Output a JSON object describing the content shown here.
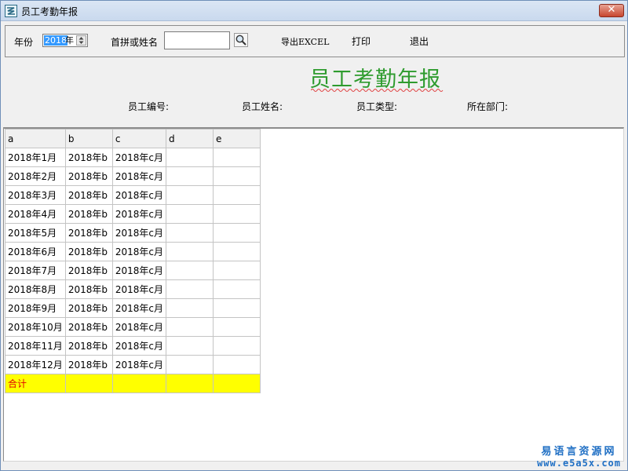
{
  "window": {
    "title": "员工考勤年报",
    "close_glyph": "✕"
  },
  "toolbar": {
    "year_label": "年份",
    "year_value": "2018",
    "year_suffix": "年",
    "search_label": "首拼或姓名",
    "search_value": "",
    "search_icon": "magnifier-icon",
    "export_label": "导出EXCEL",
    "print_label": "打印",
    "exit_label": "退出"
  },
  "report": {
    "title": "员工考勤年报",
    "fields": {
      "emp_no": "员工编号:",
      "emp_name": "员工姓名:",
      "emp_type": "员工类型:",
      "dept": "所在部门:"
    }
  },
  "grid": {
    "columns": [
      "a",
      "b",
      "c",
      "d",
      "e"
    ],
    "rows": [
      [
        "2018年1月",
        "2018年b",
        "2018年c月",
        "",
        ""
      ],
      [
        "2018年2月",
        "2018年b",
        "2018年c月",
        "",
        ""
      ],
      [
        "2018年3月",
        "2018年b",
        "2018年c月",
        "",
        ""
      ],
      [
        "2018年4月",
        "2018年b",
        "2018年c月",
        "",
        ""
      ],
      [
        "2018年5月",
        "2018年b",
        "2018年c月",
        "",
        ""
      ],
      [
        "2018年6月",
        "2018年b",
        "2018年c月",
        "",
        ""
      ],
      [
        "2018年7月",
        "2018年b",
        "2018年c月",
        "",
        ""
      ],
      [
        "2018年8月",
        "2018年b",
        "2018年c月",
        "",
        ""
      ],
      [
        "2018年9月",
        "2018年b",
        "2018年c月",
        "",
        ""
      ],
      [
        "2018年10月",
        "2018年b",
        "2018年c月",
        "",
        ""
      ],
      [
        "2018年11月",
        "2018年b",
        "2018年c月",
        "",
        ""
      ],
      [
        "2018年12月",
        "2018年b",
        "2018年c月",
        "",
        ""
      ]
    ],
    "total_row": [
      "合计",
      "",
      "",
      "",
      ""
    ],
    "total_color": "#ffff00",
    "total_text_color": "#e00000"
  },
  "watermark": {
    "line1": "易语言资源网",
    "line2": "www.e5a5x.com"
  },
  "colors": {
    "title_green": "#2e9b2e",
    "selection_blue": "#3399ff",
    "watermark_blue": "#1f6fc4"
  }
}
